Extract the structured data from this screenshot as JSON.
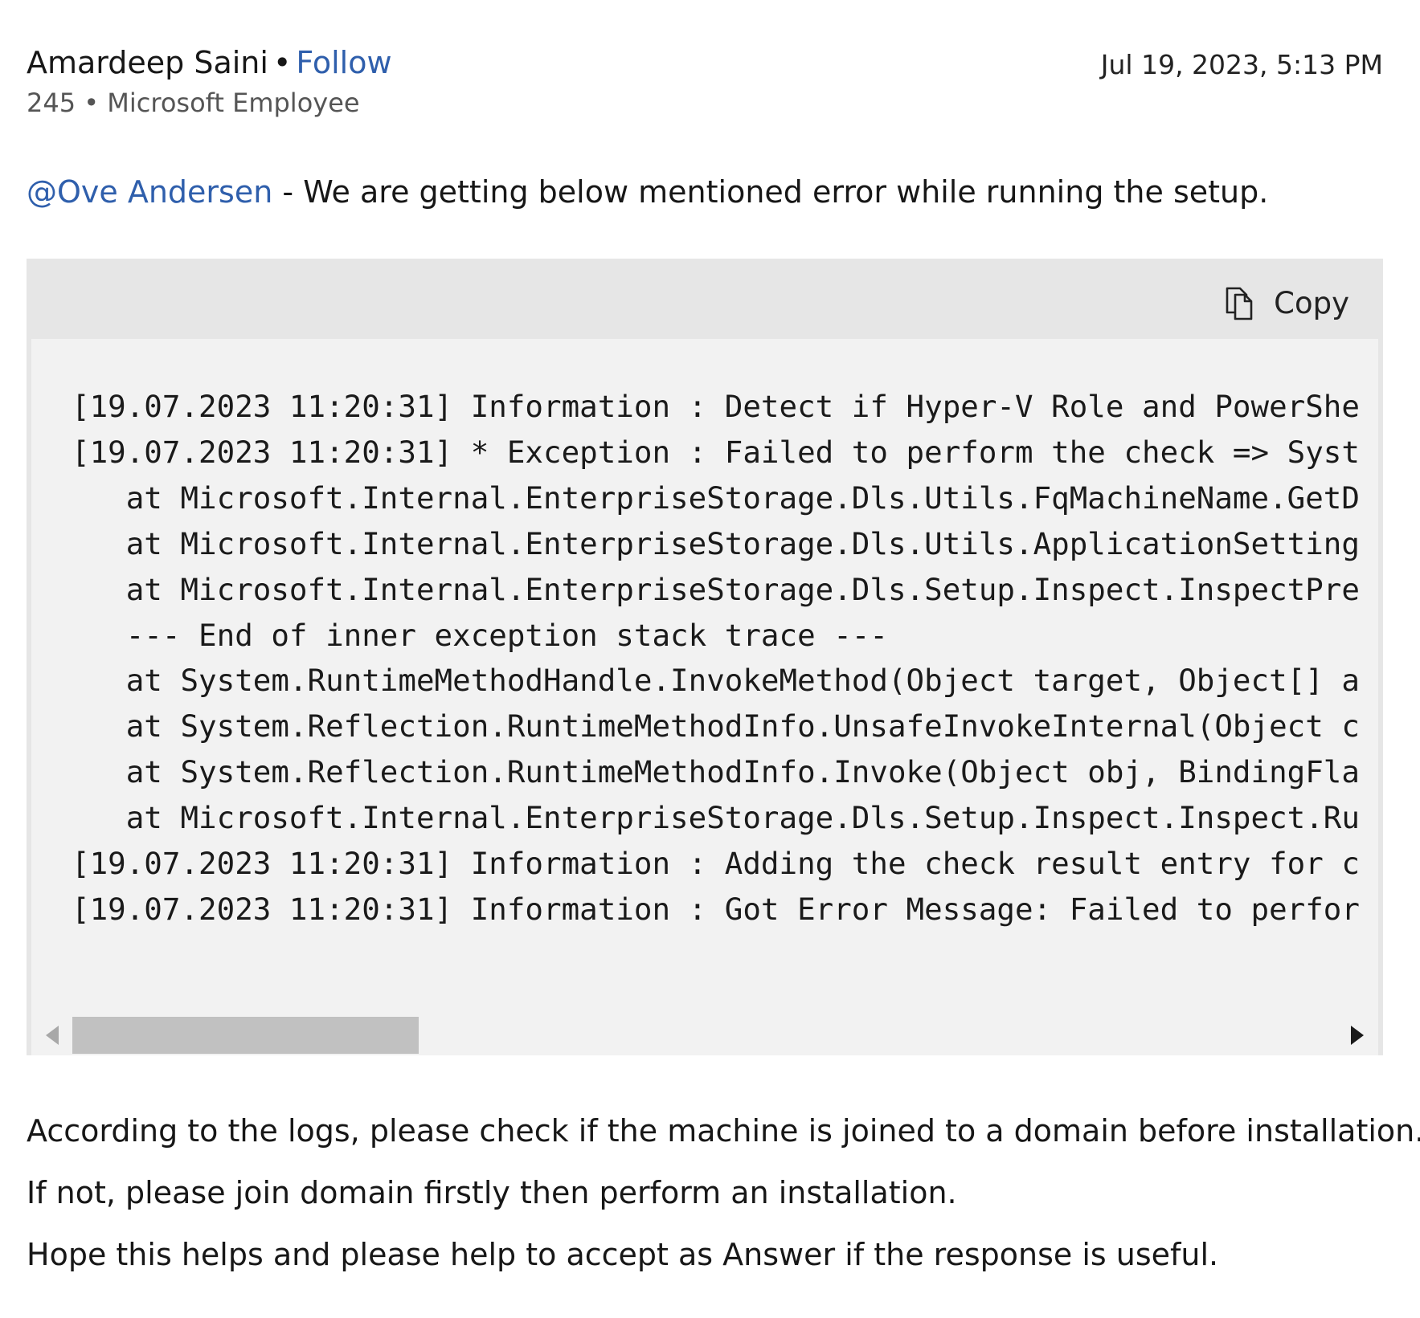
{
  "post": {
    "author": "Amardeep Saini",
    "separator": "•",
    "follow_label": "Follow",
    "reputation": "245",
    "meta_separator": "•",
    "role": "Microsoft Employee",
    "timestamp": "Jul 19, 2023, 5:13 PM",
    "mention": "@Ove Andersen",
    "intro_text": " - We are getting below mentioned error while running the setup."
  },
  "code_block": {
    "copy_label": "Copy",
    "copy_icon": "copy-icon",
    "lines": [
      "[19.07.2023 11:20:31] Information : Detect if Hyper-V Role and PowerShe",
      "[19.07.2023 11:20:31] * Exception : Failed to perform the check => Syst",
      "   at Microsoft.Internal.EnterpriseStorage.Dls.Utils.FqMachineName.GetD",
      "   at Microsoft.Internal.EnterpriseStorage.Dls.Utils.ApplicationSetting",
      "   at Microsoft.Internal.EnterpriseStorage.Dls.Setup.Inspect.InspectPre",
      "   --- End of inner exception stack trace ---",
      "   at System.RuntimeMethodHandle.InvokeMethod(Object target, Object[] a",
      "   at System.Reflection.RuntimeMethodInfo.UnsafeInvokeInternal(Object c",
      "   at System.Reflection.RuntimeMethodInfo.Invoke(Object obj, BindingFla",
      "   at Microsoft.Internal.EnterpriseStorage.Dls.Setup.Inspect.Inspect.Ru",
      "[19.07.2023 11:20:31] Information : Adding the check result entry for c",
      "[19.07.2023 11:20:31] Information : Got Error Message: Failed to perfor"
    ],
    "scroll_position": 0
  },
  "answer": {
    "paragraphs": [
      "According to the logs, please check if the machine is joined to a domain before installation.",
      "If not, please join domain firstly then perform an installation.",
      "Hope this helps and please help to accept as Answer if the response is useful."
    ]
  },
  "colors": {
    "link": "#2f5fac",
    "code_background": "#f2f2f2",
    "code_header": "#e6e6e6",
    "scroll_thumb": "#c1c1c1"
  }
}
